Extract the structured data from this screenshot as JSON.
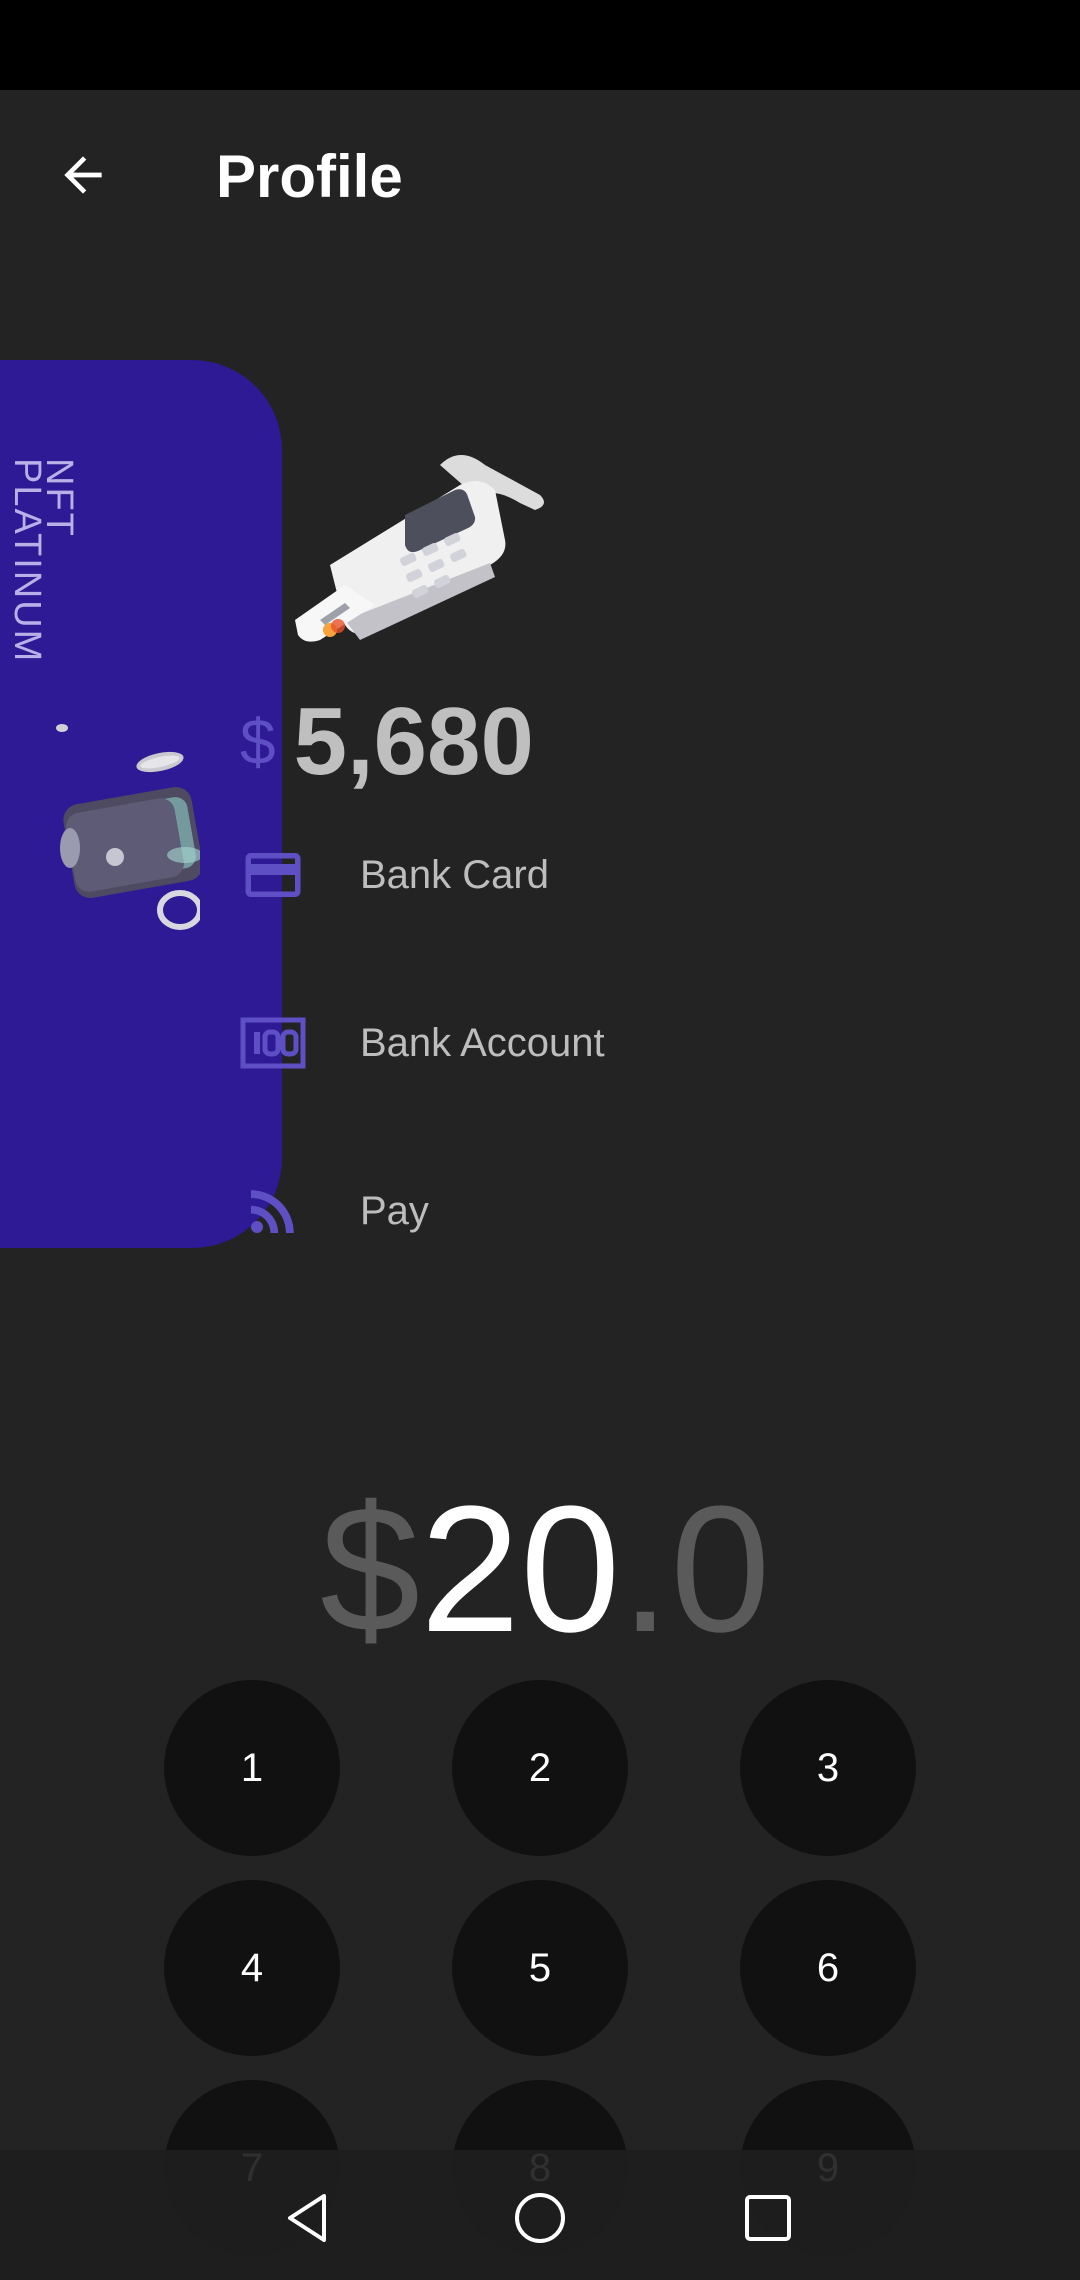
{
  "app_bar": {
    "title": "Profile",
    "back_icon": "arrow-back-icon"
  },
  "card": {
    "name_line1": "NFT",
    "name_line2": "PLATINUM",
    "background": "#2d1a94",
    "art_icon": "wallet-coins-illustration"
  },
  "terminal": {
    "art_icon": "card-terminal-illustration"
  },
  "balance": {
    "currency": "$",
    "value": "5,680"
  },
  "menu": [
    {
      "label": "Bank Card",
      "icon": "credit-card-icon"
    },
    {
      "label": "Bank Account",
      "icon": "bank-account-icon"
    },
    {
      "label": "Pay",
      "icon": "contactless-pay-icon"
    }
  ],
  "amount": {
    "currency": "$",
    "whole": "20",
    "separator": ".",
    "fraction": "0"
  },
  "keypad": {
    "keys": [
      "1",
      "2",
      "3",
      "4",
      "5",
      "6",
      "7",
      "8",
      "9"
    ]
  },
  "colors": {
    "accent": "#5e4fc4",
    "background": "#232323",
    "key_background": "#111111"
  }
}
